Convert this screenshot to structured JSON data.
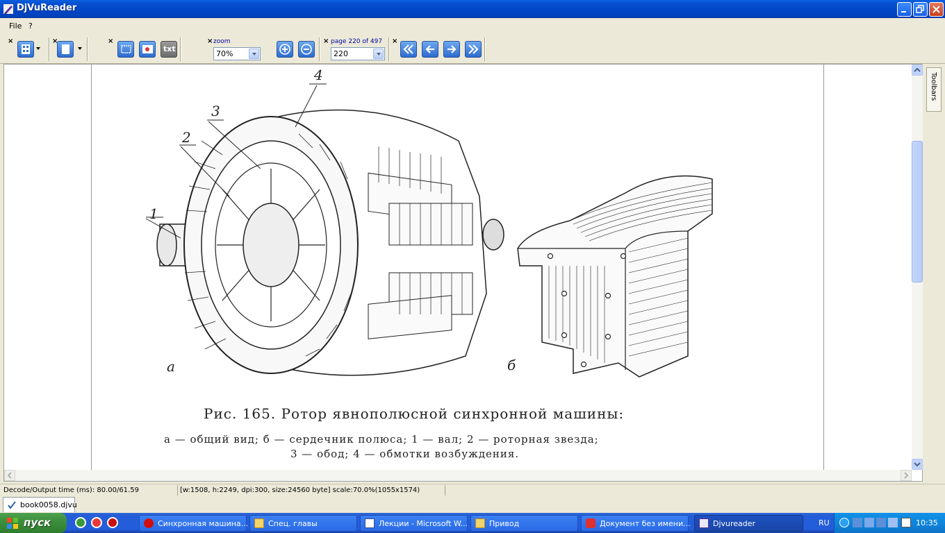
{
  "window": {
    "title": "DjVuReader"
  },
  "menu": {
    "file": "File",
    "help": "?"
  },
  "toolbar": {
    "zoom_label": "zoom",
    "zoom_value": "70%",
    "page_label": "page 220 of 497",
    "page_value": "220",
    "txt_label": "txt"
  },
  "page": {
    "fig_labels": {
      "n1": "1",
      "n2": "2",
      "n3": "3",
      "n4": "4",
      "a": "a",
      "b": "б"
    },
    "caption_title": "Рис. 165. Ротор явнополюсной синхронной машины:",
    "caption_line1": "а — общий вид; б — сердечник полюса; 1 — вал; 2 — роторная звезда;",
    "caption_line2": "3 — обод; 4 — обмотки возбуждения."
  },
  "side": {
    "toolbars": "Toolbars"
  },
  "status": {
    "decode": "Decode/Output time (ms): 80.00/61.59",
    "info": "[w:1508, h:2249, dpi:300, size:24560 byte] scale:70.0%(1055x1574)"
  },
  "doc_tab": "book0058.djvu",
  "taskbar": {
    "start": "пуск",
    "tasks": [
      {
        "label": "Синхронная машина..."
      },
      {
        "label": "Спец. главы"
      },
      {
        "label": "Лекции - Microsoft W..."
      },
      {
        "label": "Привод"
      },
      {
        "label": "Документ без имени..."
      },
      {
        "label": "Djvureader"
      }
    ],
    "lang": "RU",
    "clock": "10:35"
  },
  "colors": {
    "title_blue": "#0046c8",
    "taskbar_blue": "#245ddb",
    "start_green": "#3c8f3c"
  }
}
